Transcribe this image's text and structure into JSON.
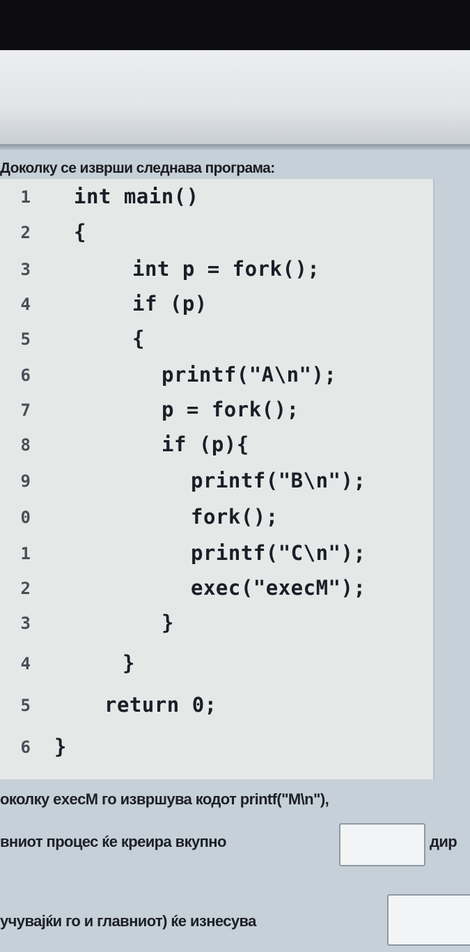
{
  "intro_text": "Доколку се изврши следнава програма:",
  "code_lines": [
    {
      "n": "1",
      "text": "int main()"
    },
    {
      "n": "2",
      "text": "{"
    },
    {
      "n": "3",
      "text": "int p = fork();"
    },
    {
      "n": "4",
      "text": "if (p)"
    },
    {
      "n": "5",
      "text": "{"
    },
    {
      "n": "6",
      "text": "printf(\"A\\n\");"
    },
    {
      "n": "7",
      "text": "p = fork();"
    },
    {
      "n": "8",
      "text": "if (p){"
    },
    {
      "n": "9",
      "text": "printf(\"B\\n\");"
    },
    {
      "n": "0",
      "text": "fork();"
    },
    {
      "n": "1",
      "text": "printf(\"C\\n\");"
    },
    {
      "n": "2",
      "text": "exec(\"execM\");"
    },
    {
      "n": "3",
      "text": "}"
    },
    {
      "n": "4",
      "text": "}"
    },
    {
      "n": "5",
      "text": "return 0;"
    },
    {
      "n": "6",
      "text": "}"
    }
  ],
  "question": {
    "line1": "околку execM го извршува кодот printf(\"M\\n\"),",
    "line2_prefix": "вниот процес ќе креира вкупно",
    "line2_suffix": "дир",
    "line3_prefix": "учувајќи го и главниот) ќе изнесува"
  }
}
